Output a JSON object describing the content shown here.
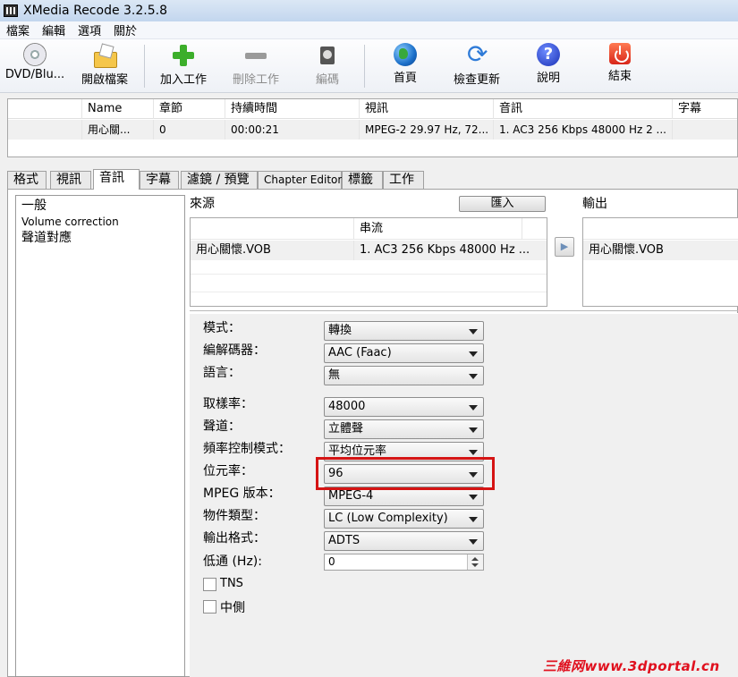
{
  "window": {
    "title": "XMedia Recode 3.2.5.8"
  },
  "menu": [
    "檔案",
    "編輯",
    "選項",
    "關於"
  ],
  "toolbar": {
    "dvd": "DVD/Blu...",
    "open": "開啟檔案",
    "add_job": "加入工作",
    "remove_job": "刪除工作",
    "encode": "編碼",
    "home": "首頁",
    "update": "檢查更新",
    "help": "說明",
    "exit": "結束"
  },
  "file_table": {
    "headers": [
      "Name",
      "章節",
      "持續時間",
      "視訊",
      "音訊",
      "字幕"
    ],
    "row": [
      "用心關...",
      "0",
      "00:00:21",
      "MPEG-2 29.97 Hz, 72...",
      "1. AC3 256 Kbps 48000 Hz 2 ...",
      ""
    ]
  },
  "tabs": [
    "格式",
    "視訊",
    "音訊",
    "字幕",
    "濾鏡 / 預覽",
    "Chapter Editor",
    "標籤",
    "工作"
  ],
  "active_tab": "音訊",
  "side_list": [
    "一般",
    "Volume correction",
    "聲道對應"
  ],
  "source": {
    "label": "來源",
    "import_button": "匯入",
    "header": "串流",
    "row": [
      "用心關懷.VOB",
      "1. AC3 256 Kbps 48000 Hz ..."
    ]
  },
  "output": {
    "label": "輸出",
    "row": "用心關懷.VOB"
  },
  "settings": {
    "mode_label": "模式：",
    "mode_value": "轉換",
    "codec_label": "編解碼器：",
    "codec_value": "AAC (Faac)",
    "language_label": "語言：",
    "language_value": "無",
    "samplerate_label": "取樣率：",
    "samplerate_value": "48000",
    "channels_label": "聲道：",
    "channels_value": "立體聲",
    "ratecontrol_label": "頻率控制模式：",
    "ratecontrol_value": "平均位元率",
    "bitrate_label": "位元率：",
    "bitrate_value": "96",
    "mpeg_label": "MPEG 版本：",
    "mpeg_value": "MPEG-4",
    "object_label": "物件類型：",
    "object_value": "LC (Low Complexity)",
    "output_format_label": "輸出格式：",
    "output_format_value": "ADTS",
    "lowpass_label": "低通 (Hz):",
    "lowpass_value": "0",
    "tns_label": "TNS",
    "mid_label": "中側"
  },
  "watermark": "三維网www.3dportal.cn"
}
